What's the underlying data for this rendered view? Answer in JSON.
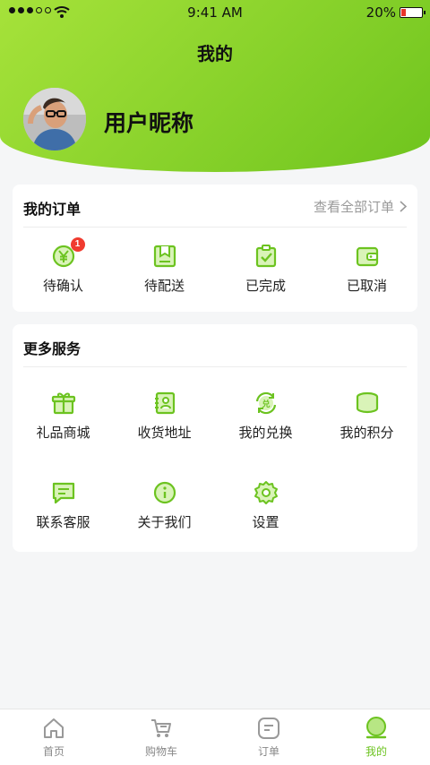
{
  "status_bar": {
    "time": "9:41 AM",
    "battery": "20%",
    "battery_level": 0.2
  },
  "header": {
    "title": "我的",
    "nickname": "用户昵称"
  },
  "orders": {
    "title": "我的订单",
    "view_all": "查看全部订单",
    "items": [
      {
        "label": "待确认",
        "icon": "yen-coin-icon",
        "badge": "1"
      },
      {
        "label": "待配送",
        "icon": "delivery-box-icon"
      },
      {
        "label": "已完成",
        "icon": "clipboard-check-icon"
      },
      {
        "label": "已取消",
        "icon": "wallet-icon"
      }
    ]
  },
  "services": {
    "title": "更多服务",
    "items": [
      {
        "label": "礼品商城",
        "icon": "gift-icon"
      },
      {
        "label": "收货地址",
        "icon": "address-book-icon"
      },
      {
        "label": "我的兑换",
        "icon": "exchange-icon"
      },
      {
        "label": "我的积分",
        "icon": "coins-icon"
      },
      {
        "label": "联系客服",
        "icon": "chat-icon"
      },
      {
        "label": "关于我们",
        "icon": "info-icon"
      },
      {
        "label": "设置",
        "icon": "settings-gear-icon"
      }
    ]
  },
  "tabbar": {
    "items": [
      {
        "label": "首页",
        "icon": "home-icon",
        "active": false
      },
      {
        "label": "购物车",
        "icon": "cart-icon",
        "active": false
      },
      {
        "label": "订单",
        "icon": "order-list-icon",
        "active": false
      },
      {
        "label": "我的",
        "icon": "profile-icon",
        "active": true
      }
    ]
  },
  "colors": {
    "accent": "#6cc320",
    "header_start": "#a6e23a",
    "header_end": "#6fc41e",
    "badge": "#f03b2f"
  }
}
